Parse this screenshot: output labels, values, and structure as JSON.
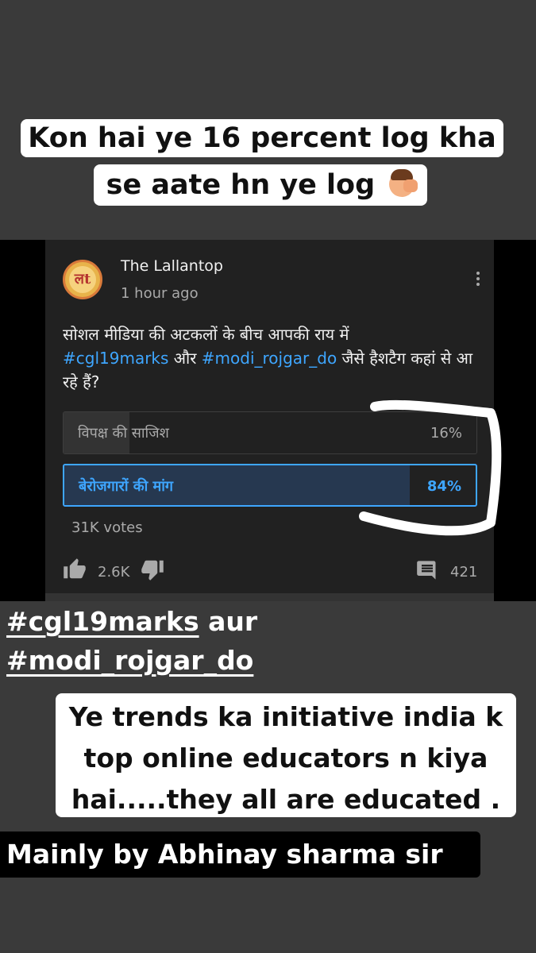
{
  "story": {
    "caption_line1": "Kon hai ye 16 percent log kha",
    "caption_line2": "se aate hn ye log",
    "caption_emoji": "face-palm-emoji",
    "hashtag_line1_tag": "#cgl19marks",
    "hashtag_line1_rest": " aur",
    "hashtag_line2_tag": "#modi_rojgar_do",
    "caption3_line1": "Ye trends ka initiative india k",
    "caption3_line2": "top online educators n kiya",
    "caption3_line3": "hai.....they all are educated .",
    "caption4": "Mainly by Abhinay sharma sir"
  },
  "post": {
    "avatar_text": "लt",
    "channel_name": "The Lallantop",
    "time": "1 hour ago",
    "text_part1": "सोशल मीडिया की अटकलों के बीच आपकी राय में",
    "tag1": "#cgl19marks",
    "text_part2": " और ",
    "tag2": "#modi_rojgar_do",
    "text_part3": " जैसे हैशटैग कहां से आ रहे हैं?",
    "poll": [
      {
        "label": "विपक्ष की साजिश",
        "percent": "16%",
        "value": 16,
        "selected": false
      },
      {
        "label": "बेरोजगारों की मांग",
        "percent": "84%",
        "value": 84,
        "selected": true
      }
    ],
    "votes": "31K votes",
    "likes": "2.6K",
    "comments": "421"
  },
  "colors": {
    "background": "#3a3a3a",
    "post_bg": "#212121",
    "accent_blue": "#3ea6ff",
    "muted_text": "#aaaaaa"
  }
}
